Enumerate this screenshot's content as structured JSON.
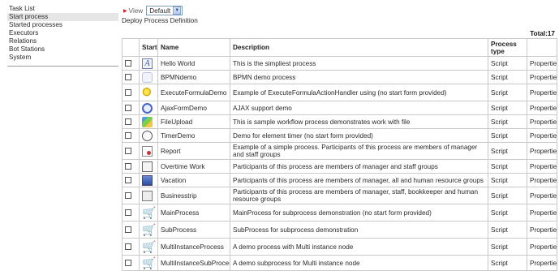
{
  "sidebar": {
    "items": [
      {
        "label": "Task List",
        "active": false
      },
      {
        "label": "Start process",
        "active": true
      },
      {
        "label": "Started processes",
        "active": false
      },
      {
        "label": "Executors",
        "active": false
      },
      {
        "label": "Relations",
        "active": false
      },
      {
        "label": "Bot Stations",
        "active": false
      },
      {
        "label": "System",
        "active": false
      }
    ]
  },
  "toolbar": {
    "view_label": "View",
    "view_value": "Default",
    "deploy_link": "Deploy Process Definition"
  },
  "summary": {
    "total": "Total:17"
  },
  "table": {
    "headers": {
      "start": "Start",
      "name": "Name",
      "description": "Description",
      "type": "Process type"
    },
    "rows": [
      {
        "icon": "letter-a-icon",
        "name": "Hello World",
        "description": "This is the simpliest process",
        "type": "Script",
        "action": "Properties"
      },
      {
        "icon": "bpmn-icon",
        "name": "BPMNdemo",
        "description": "BPMN demo process",
        "type": "Script",
        "action": "Properties"
      },
      {
        "icon": "key-icon",
        "name": "ExecuteFormulaDemo",
        "description": "Example of ExecuteFormulaActionHandler using (no start form provided)",
        "type": "Script",
        "action": "Properties"
      },
      {
        "icon": "ajax-icon",
        "name": "AjaxFormDemo",
        "description": "AJAX support demo",
        "type": "Script",
        "action": "Properties"
      },
      {
        "icon": "file-upload-icon",
        "name": "FileUpload",
        "description": "This is sample workflow process demonstrates work with file",
        "type": "Script",
        "action": "Properties"
      },
      {
        "icon": "timer-icon",
        "name": "TimerDemo",
        "description": "Demo for element timer (no start form provided)",
        "type": "Script",
        "action": "Properties"
      },
      {
        "icon": "report-icon",
        "name": "Report",
        "description": "Example of a simple process. Participants of this process are members of manager and staff groups",
        "type": "Script",
        "action": "Properties"
      },
      {
        "icon": "document-icon",
        "name": "Overtime Work",
        "description": "Participants of this process are members of manager and staff groups",
        "type": "Script",
        "action": "Properties"
      },
      {
        "icon": "vacation-icon",
        "name": "Vacation",
        "description": "Participants of this process are members of manager, all and human resource groups",
        "type": "Script",
        "action": "Properties"
      },
      {
        "icon": "business-trip-icon",
        "name": "Businesstrip",
        "description": "Participants of this process are members of manager, staff, bookkeeper and human resource groups",
        "type": "Script",
        "action": "Properties"
      },
      {
        "icon": "cart-icon",
        "name": "MainProcess",
        "description": "MainProcess for subprocess demonstration (no start form provided)",
        "type": "Script",
        "action": "Properties"
      },
      {
        "icon": "cart-icon",
        "name": "SubProcess",
        "description": "SubProcess for subprocess demonstration",
        "type": "Script",
        "action": "Properties"
      },
      {
        "icon": "cart-icon",
        "name": "MultiInstanceProcess",
        "description": "A demo process with Multi instance node",
        "type": "Script",
        "action": "Properties"
      },
      {
        "icon": "cart-icon",
        "name": "MultiInstanceSubProcess",
        "description": "A demo subprocess for Multi instance node",
        "type": "Script",
        "action": "Properties"
      }
    ]
  }
}
